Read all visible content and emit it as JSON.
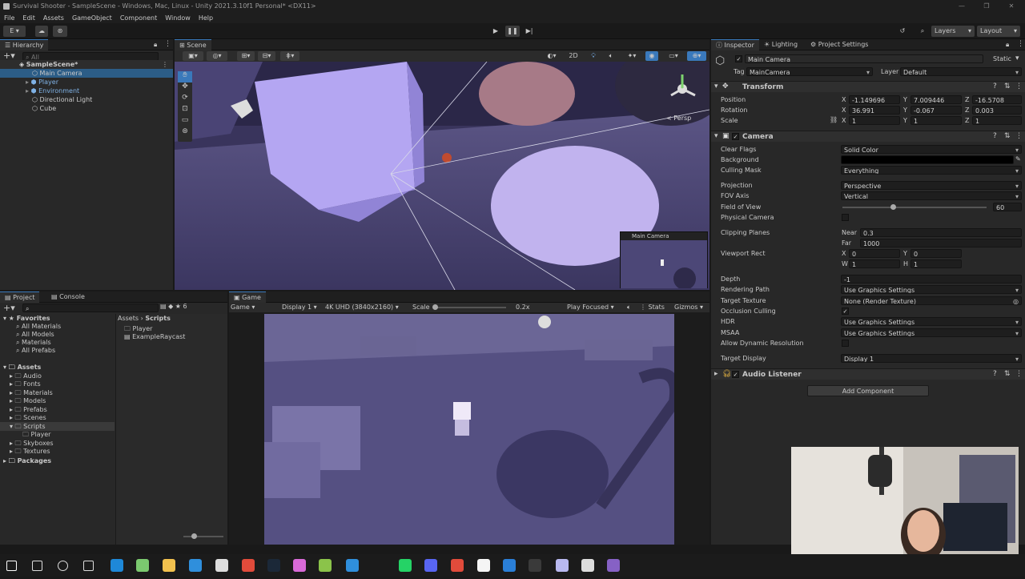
{
  "window": {
    "title": "Survival Shooter - SampleScene - Windows, Mac, Linux - Unity 2021.3.10f1 Personal* <DX11>"
  },
  "menu": [
    "File",
    "Edit",
    "Assets",
    "GameObject",
    "Component",
    "Window",
    "Help"
  ],
  "toolbar": {
    "account_label": "E",
    "layers_label": "Layers",
    "layout_label": "Layout"
  },
  "hierarchy": {
    "tab": "Hierarchy",
    "search_placeholder": "All",
    "scene_name": "SampleScene*",
    "items": [
      "Main Camera",
      "Player",
      "Environment",
      "Directional Light",
      "Cube"
    ]
  },
  "scene": {
    "tab": "Scene",
    "mode_2d": "2D",
    "persp_label": "< Persp",
    "camera_preview_title": "Main Camera"
  },
  "project": {
    "tab_project": "Project",
    "tab_console": "Console",
    "count": "6",
    "favorites_label": "Favorites",
    "favorites": [
      "All Materials",
      "All Models",
      "Materials",
      "All Prefabs"
    ],
    "assets_label": "Assets",
    "assets": [
      "Audio",
      "Fonts",
      "Materials",
      "Models",
      "Prefabs",
      "Scenes",
      "Scripts"
    ],
    "scripts_child": "Player",
    "assets_after": [
      "Skyboxes",
      "Textures"
    ],
    "packages_label": "Packages",
    "breadcrumb_root": "Assets",
    "breadcrumb_sep": "›",
    "breadcrumb_leaf": "Scripts",
    "files": [
      "Player",
      "ExampleRaycast"
    ]
  },
  "game": {
    "tab": "Game",
    "mode": "Game",
    "display": "Display 1",
    "resolution": "4K UHD (3840x2160)",
    "scale_label": "Scale",
    "scale_value": "0.2x",
    "play_focused": "Play Focused",
    "stats": "Stats",
    "gizmos": "Gizmos"
  },
  "inspector": {
    "tab_inspector": "Inspector",
    "tab_lighting": "Lighting",
    "tab_project_settings": "Project Settings",
    "object_name": "Main Camera",
    "static_label": "Static",
    "tag_label": "Tag",
    "tag_value": "MainCamera",
    "layer_label": "Layer",
    "layer_value": "Default",
    "transform": {
      "header": "Transform",
      "position_label": "Position",
      "rotation_label": "Rotation",
      "scale_label": "Scale",
      "position": {
        "x": "-1.149696",
        "y": "7.009446",
        "z": "-16.5708"
      },
      "rotation": {
        "x": "36.991",
        "y": "-0.067",
        "z": "0.003"
      },
      "scale": {
        "x": "1",
        "y": "1",
        "z": "1"
      }
    },
    "camera": {
      "header": "Camera",
      "clear_flags_label": "Clear Flags",
      "clear_flags": "Solid Color",
      "background_label": "Background",
      "culling_mask_label": "Culling Mask",
      "culling_mask": "Everything",
      "projection_label": "Projection",
      "projection": "Perspective",
      "fov_axis_label": "FOV Axis",
      "fov_axis": "Vertical",
      "fov_label": "Field of View",
      "fov_value": "60",
      "physical_camera_label": "Physical Camera",
      "clipping_planes_label": "Clipping Planes",
      "near_label": "Near",
      "near_value": "0.3",
      "far_label": "Far",
      "far_value": "1000",
      "viewport_rect_label": "Viewport Rect",
      "viewport": {
        "x": "0",
        "y": "0",
        "w": "1",
        "h": "1"
      },
      "depth_label": "Depth",
      "depth_value": "-1",
      "rendering_path_label": "Rendering Path",
      "rendering_path": "Use Graphics Settings",
      "target_texture_label": "Target Texture",
      "target_texture": "None (Render Texture)",
      "occlusion_culling_label": "Occlusion Culling",
      "hdr_label": "HDR",
      "hdr": "Use Graphics Settings",
      "msaa_label": "MSAA",
      "msaa": "Use Graphics Settings",
      "allow_dynamic_resolution_label": "Allow Dynamic Resolution",
      "target_display_label": "Target Display",
      "target_display": "Display 1"
    },
    "audio_listener_header": "Audio Listener",
    "add_component": "Add Component"
  },
  "taskbar_icons": [
    "windows-start-icon",
    "search-icon",
    "cortana-icon",
    "task-view-icon",
    "edge-icon",
    "store-icon",
    "explorer-icon",
    "mail-icon",
    "unity-hub-icon",
    "chrome-icon",
    "steam-icon",
    "app-icon",
    "app-icon",
    "app-icon",
    "whatsapp-icon",
    "discord-icon",
    "chrome-icon",
    "notion-icon",
    "vscode-icon",
    "obs-icon",
    "app-icon",
    "unity-icon",
    "visual-studio-icon"
  ]
}
